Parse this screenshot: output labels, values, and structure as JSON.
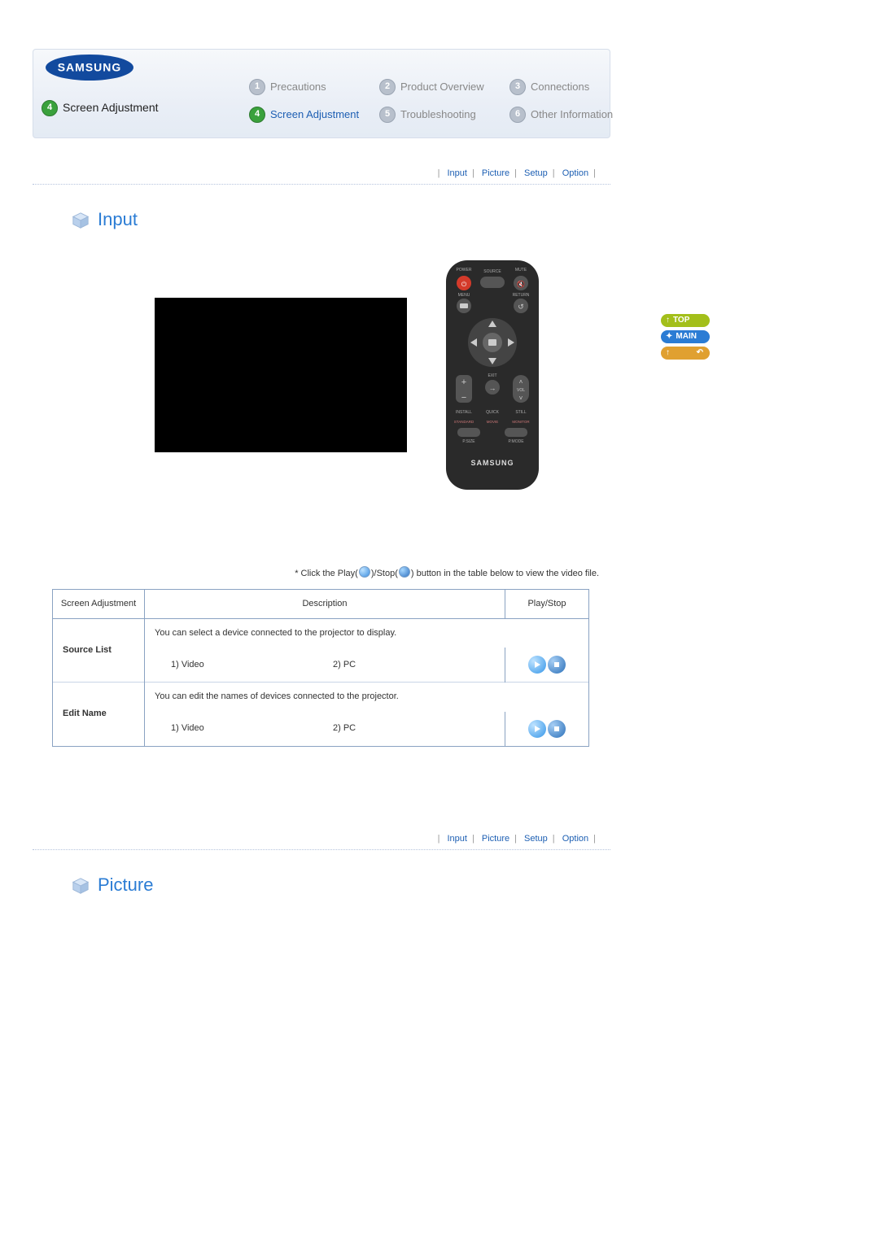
{
  "brand": "SAMSUNG",
  "header": {
    "current_section_num": "4",
    "current_section_label": "Screen Adjustment",
    "nav": [
      {
        "num": "1",
        "label": "Precautions",
        "active": false
      },
      {
        "num": "2",
        "label": "Product Overview",
        "active": false
      },
      {
        "num": "3",
        "label": "Connections",
        "active": false
      },
      {
        "num": "4",
        "label": "Screen Adjustment",
        "active": true
      },
      {
        "num": "5",
        "label": "Troubleshooting",
        "active": false
      },
      {
        "num": "6",
        "label": "Other Information",
        "active": false
      }
    ]
  },
  "subnav": {
    "items": [
      "Input",
      "Picture",
      "Setup",
      "Option"
    ]
  },
  "sections": {
    "input_title": "Input",
    "picture_title": "Picture"
  },
  "side_buttons": {
    "top": "TOP",
    "main": "MAIN"
  },
  "note_prefix": "* Click the Play(",
  "note_mid": ")/Stop(",
  "note_suffix": ") button in the table below to view the video file.",
  "table": {
    "headers": {
      "col1": "Screen Adjustment",
      "col2": "Description",
      "col3": "Play/Stop"
    },
    "rows": [
      {
        "label": "Source List",
        "desc": "You can select a device connected to the projector to display.",
        "opts": {
          "a": "1) Video",
          "b": "2) PC"
        }
      },
      {
        "label": "Edit Name",
        "desc": "You can edit the names of devices connected to the projector.",
        "opts": {
          "a": "1) Video",
          "b": "2) PC"
        }
      }
    ]
  },
  "remote_labels": {
    "power": "POWER",
    "source": "SOURCE",
    "mute": "MUTE",
    "menu": "MENU",
    "return": "RETURN",
    "exit": "EXIT",
    "vol": "VOL",
    "install": "INSTALL",
    "quick": "QUICK",
    "still": "STILL",
    "standard": "STANDARD",
    "movie": "MOVIE",
    "monitor": "MONITOR",
    "psize": "P.SIZE",
    "pmode": "P.MODE",
    "brand": "SAMSUNG"
  }
}
